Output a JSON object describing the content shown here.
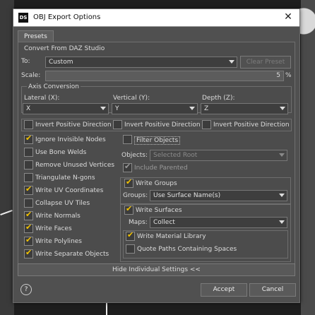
{
  "window": {
    "title": "OBJ Export Options",
    "close": "✕",
    "app_icon": "DS"
  },
  "tabs": [
    {
      "label": "Presets"
    }
  ],
  "convert": {
    "section": "Convert From DAZ Studio",
    "to_label": "To:",
    "to_value": "Custom",
    "clear_preset": "Clear Preset",
    "scale_label": "Scale:",
    "scale_value": "5",
    "scale_unit": "%"
  },
  "axis": {
    "section": "Axis Conversion",
    "lateral_label": "Lateral (X):",
    "lateral_value": "X",
    "vertical_label": "Vertical (Y):",
    "vertical_value": "Y",
    "depth_label": "Depth (Z):",
    "depth_value": "Z",
    "invert_label": "Invert Positive Direction"
  },
  "left_options": [
    {
      "label": "Ignore Invisible Nodes",
      "checked": true
    },
    {
      "label": "Use Bone Welds",
      "checked": false
    },
    {
      "label": "Remove Unused Vertices",
      "checked": false
    },
    {
      "label": "Triangulate N-gons",
      "checked": false
    },
    {
      "label": "Write UV Coordinates",
      "checked": true
    },
    {
      "label": "Collapse UV Tiles",
      "checked": false
    },
    {
      "label": "Write Normals",
      "checked": true
    },
    {
      "label": "Write Faces",
      "checked": true
    },
    {
      "label": "Write Polylines",
      "checked": true
    },
    {
      "label": "Write Separate Objects",
      "checked": true
    }
  ],
  "right": {
    "filter_objects": "Filter Objects",
    "objects_label": "Objects:",
    "objects_value": "Selected Root",
    "include_parented": "Include Parented",
    "write_groups": "Write Groups",
    "groups_label": "Groups:",
    "groups_value": "Use Surface Name(s)",
    "write_surfaces": "Write Surfaces",
    "maps_label": "Maps:",
    "maps_value": "Collect",
    "write_material_library": "Write Material Library",
    "quote_paths": "Quote Paths Containing Spaces"
  },
  "hide_settings": "Hide Individual Settings <<",
  "footer": {
    "help": "?",
    "accept": "Accept",
    "cancel": "Cancel"
  }
}
